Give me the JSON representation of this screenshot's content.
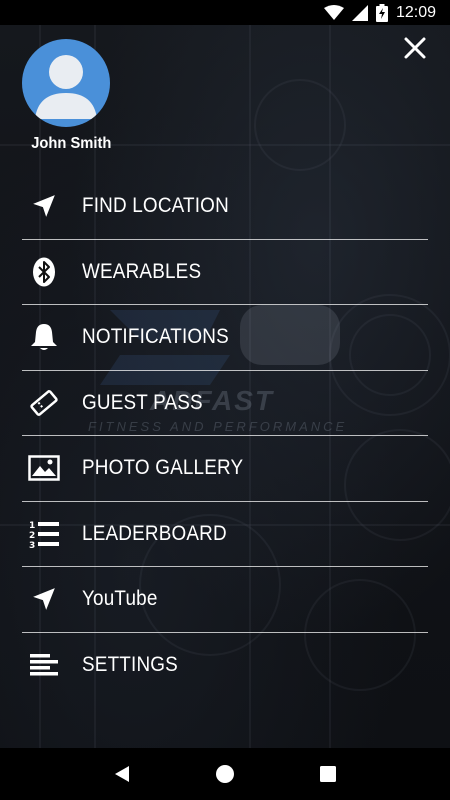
{
  "status_bar": {
    "time": "12:09",
    "icons": [
      "wifi-icon",
      "cell-signal-icon",
      "battery-charging-icon"
    ]
  },
  "drawer": {
    "close_icon": "close-icon",
    "user": {
      "name": "John Smith",
      "avatar_color": "#4a90d9"
    },
    "menu_items": [
      {
        "label": "FIND LOCATION",
        "icon": "navigation-arrow-icon"
      },
      {
        "label": "WEARABLES",
        "icon": "bluetooth-icon"
      },
      {
        "label": "NOTIFICATIONS",
        "icon": "bell-icon"
      },
      {
        "label": "GUEST PASS",
        "icon": "ticket-icon"
      },
      {
        "label": "PHOTO GALLERY",
        "icon": "image-icon"
      },
      {
        "label": "LEADERBOARD",
        "icon": "numbered-list-icon"
      },
      {
        "label": "YouTube",
        "icon": "navigation-arrow-icon"
      },
      {
        "label": "SETTINGS",
        "icon": "align-lines-icon"
      }
    ],
    "background": {
      "watermark_text": "ADFAST",
      "watermark_subtext": "FITNESS AND PERFORMANCE"
    }
  },
  "nav_bar": {
    "icons": [
      "back-icon",
      "home-icon",
      "recents-icon"
    ]
  }
}
